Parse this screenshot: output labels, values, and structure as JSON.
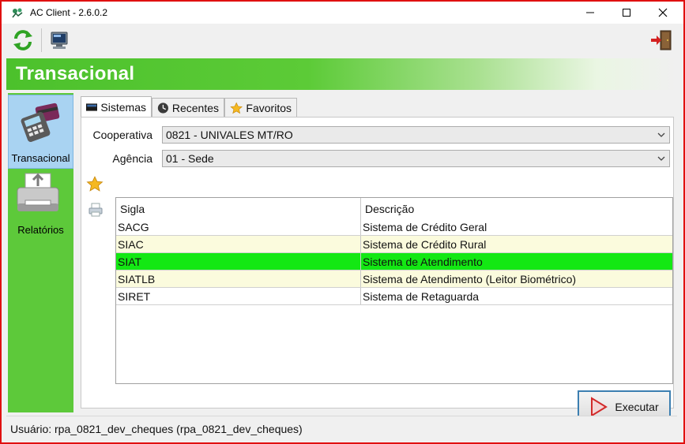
{
  "window": {
    "title": "AC Client  - 2.6.0.2",
    "frame_color": "#e01010"
  },
  "banner": {
    "title": "Transacional",
    "accent": "#4cc12c"
  },
  "nav": {
    "items": [
      {
        "label": "Transacional",
        "icon": "card-terminal-icon",
        "active": true
      },
      {
        "label": "Relatórios",
        "icon": "printer-icon",
        "active": false
      }
    ]
  },
  "tabs": [
    {
      "label": "Sistemas",
      "icon": "monitor-icon",
      "active": true
    },
    {
      "label": "Recentes",
      "icon": "clock-icon",
      "active": false
    },
    {
      "label": "Favoritos",
      "icon": "star-icon",
      "active": false
    }
  ],
  "form": {
    "cooperativa_label": "Cooperativa",
    "cooperativa_value": "0821 - UNIVALES MT/RO",
    "agencia_label": "Agência",
    "agencia_value": "01 - Sede"
  },
  "table": {
    "columns": [
      "Sigla",
      "Descrição"
    ],
    "rows": [
      {
        "sigla": "SACG",
        "descricao": "Sistema de Crédito Geral"
      },
      {
        "sigla": "SIAC",
        "descricao": "Sistema de Crédito Rural"
      },
      {
        "sigla": "SIAT",
        "descricao": "Sistema de Atendimento",
        "selected": true
      },
      {
        "sigla": "SIATLB",
        "descricao": "Sistema de Atendimento (Leitor Biométrico)"
      },
      {
        "sigla": "SIRET",
        "descricao": "Sistema de Retaguarda"
      }
    ],
    "selected_color": "#13e813"
  },
  "actions": {
    "execute_label": "Executar"
  },
  "status": {
    "text": "Usuário: rpa_0821_dev_cheques (rpa_0821_dev_cheques)"
  }
}
